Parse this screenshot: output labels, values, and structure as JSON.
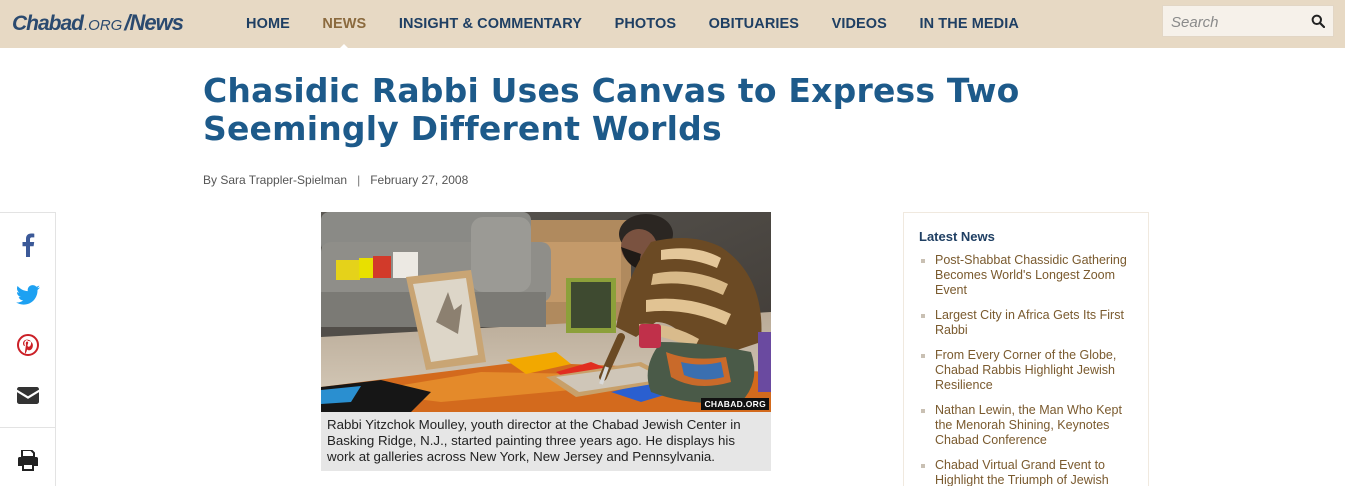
{
  "header": {
    "logo": {
      "part1": "Chabad",
      "part2": ".ORG",
      "part3": "/News"
    },
    "nav": [
      {
        "label": "HOME",
        "active": false
      },
      {
        "label": "NEWS",
        "active": true
      },
      {
        "label": "INSIGHT & COMMENTARY",
        "active": false
      },
      {
        "label": "PHOTOS",
        "active": false
      },
      {
        "label": "OBITUARIES",
        "active": false
      },
      {
        "label": "VIDEOS",
        "active": false
      },
      {
        "label": "IN THE MEDIA",
        "active": false
      }
    ],
    "search": {
      "placeholder": "Search",
      "icon": "search-icon"
    }
  },
  "article": {
    "title": "Chasidic Rabbi Uses Canvas to Express Two Seemingly Different Worlds",
    "byline": {
      "author": "By Sara Trappler-Spielman",
      "separator": "|",
      "date": "February 27, 2008"
    },
    "photo": {
      "watermark": "CHABAD.ORG",
      "caption": "Rabbi Yitzchok Moulley, youth director at the Chabad Jewish Center in Basking Ridge, N.J., started painting three years ago. He displays his work at galleries across New York, New Jersey and Pennsylvania."
    }
  },
  "share": {
    "buttons": [
      {
        "icon": "facebook-icon",
        "color": "#3b5998"
      },
      {
        "icon": "twitter-icon",
        "color": "#1da1f2"
      },
      {
        "icon": "pinterest-icon",
        "color": "#cb2027"
      },
      {
        "icon": "email-icon",
        "color": "#333333"
      },
      {
        "icon": "print-icon",
        "color": "#222222"
      }
    ]
  },
  "sidebar": {
    "heading": "Latest News",
    "items": [
      {
        "label": "Post-Shabbat Chassidic Gathering Becomes World's Longest Zoom Event"
      },
      {
        "label": "Largest City in Africa Gets Its First Rabbi"
      },
      {
        "label": "From Every Corner of the Globe, Chabad Rabbis Highlight Jewish Resilience"
      },
      {
        "label": "Nathan Lewin, the Man Who Kept the Menorah Shining, Keynotes Chabad Conference"
      },
      {
        "label": "Chabad Virtual Grand Event to Highlight the Triumph of Jewish"
      }
    ]
  },
  "colors": {
    "header_bg": "#e7d9c4",
    "nav_text": "#1f3f63",
    "nav_active": "#8b6a3e",
    "title": "#1d5a8a",
    "link": "#7a5a2e"
  }
}
